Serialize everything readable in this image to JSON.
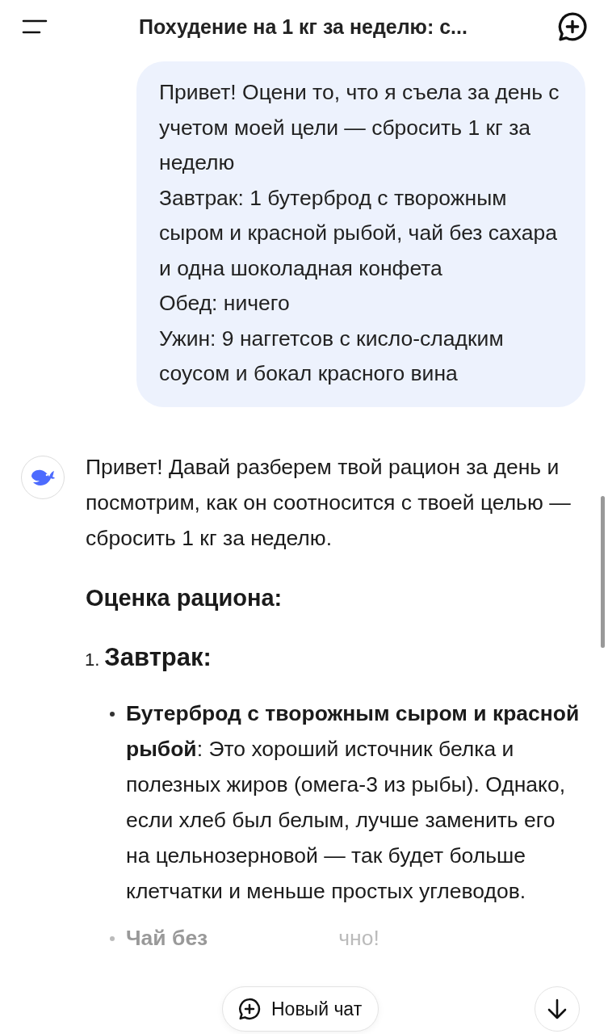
{
  "header": {
    "title": "Похудение на 1 кг за неделю: с..."
  },
  "user_message": {
    "lines": [
      "Привет! Оцени то, что я съела за день с учетом моей цели — сбросить 1 кг за неделю",
      "Завтрак: 1 бутерброд с творожным сыром и красной рыбой, чай без сахара и одна шоколадная конфета",
      "Обед: ничего",
      "Ужин: 9 наггетсов с кисло-сладким соусом и бокал красного вина"
    ]
  },
  "assistant_message": {
    "intro": "Привет! Давай разберем твой рацион за день и посмотрим, как он соотносится с твоей целью — сбросить 1 кг за неделю.",
    "section_title": "Оценка рациона:",
    "list": [
      {
        "number": "1.",
        "title": "Завтрак:",
        "bullets": [
          "**Бутерброд с творожным сыром и красной рыбой**: Это хороший источник белка и полезных жиров (омега-3 из рыбы). Однако, если хлеб был белым, лучше заменить его на цельнозерновой — так будет больше клетчатки и меньше простых углеводов."
        ]
      }
    ],
    "cut_bullet": {
      "head": "Чай без",
      "tail": "чно!"
    }
  },
  "new_chat_button": {
    "label": "Новый чат"
  }
}
